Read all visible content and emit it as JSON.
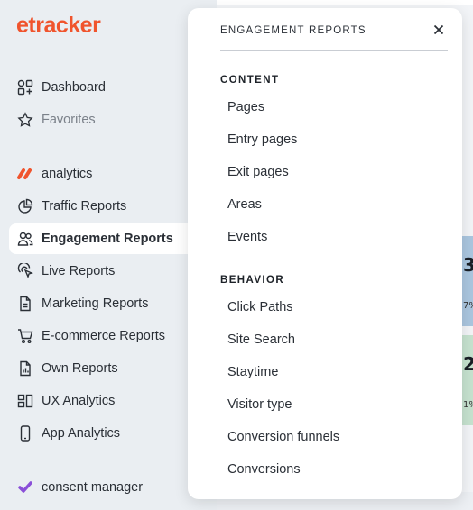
{
  "brand": {
    "logo_text": "etracker",
    "accent": "#f0542d"
  },
  "sidebar": {
    "items": [
      {
        "label": "Dashboard",
        "icon": "dashboard-grid-icon"
      },
      {
        "label": "Favorites",
        "icon": "star-icon"
      },
      {
        "label": "analytics",
        "icon": "analytics-logo-icon"
      },
      {
        "label": "Traffic Reports",
        "icon": "pie-chart-icon"
      },
      {
        "label": "Engagement Reports",
        "icon": "users-icon",
        "active": true
      },
      {
        "label": "Live Reports",
        "icon": "pointer-click-icon"
      },
      {
        "label": "Marketing Reports",
        "icon": "document-icon"
      },
      {
        "label": "E-commerce Reports",
        "icon": "cart-icon"
      },
      {
        "label": "Own Reports",
        "icon": "document-chart-icon"
      },
      {
        "label": "UX Analytics",
        "icon": "ux-analytics-icon"
      },
      {
        "label": "App Analytics",
        "icon": "mobile-icon"
      },
      {
        "label": "consent manager",
        "icon": "consent-manager-logo-icon"
      }
    ]
  },
  "panel": {
    "title": "ENGAGEMENT REPORTS",
    "sections": [
      {
        "heading": "CONTENT",
        "items": [
          "Pages",
          "Entry pages",
          "Exit pages",
          "Areas",
          "Events"
        ]
      },
      {
        "heading": "BEHAVIOR",
        "items": [
          "Click Paths",
          "Site Search",
          "Staytime",
          "Visitor type",
          "Conversion funnels",
          "Conversions"
        ]
      }
    ]
  },
  "background": {
    "values": [
      "3",
      "7%",
      "2",
      "1%"
    ]
  }
}
